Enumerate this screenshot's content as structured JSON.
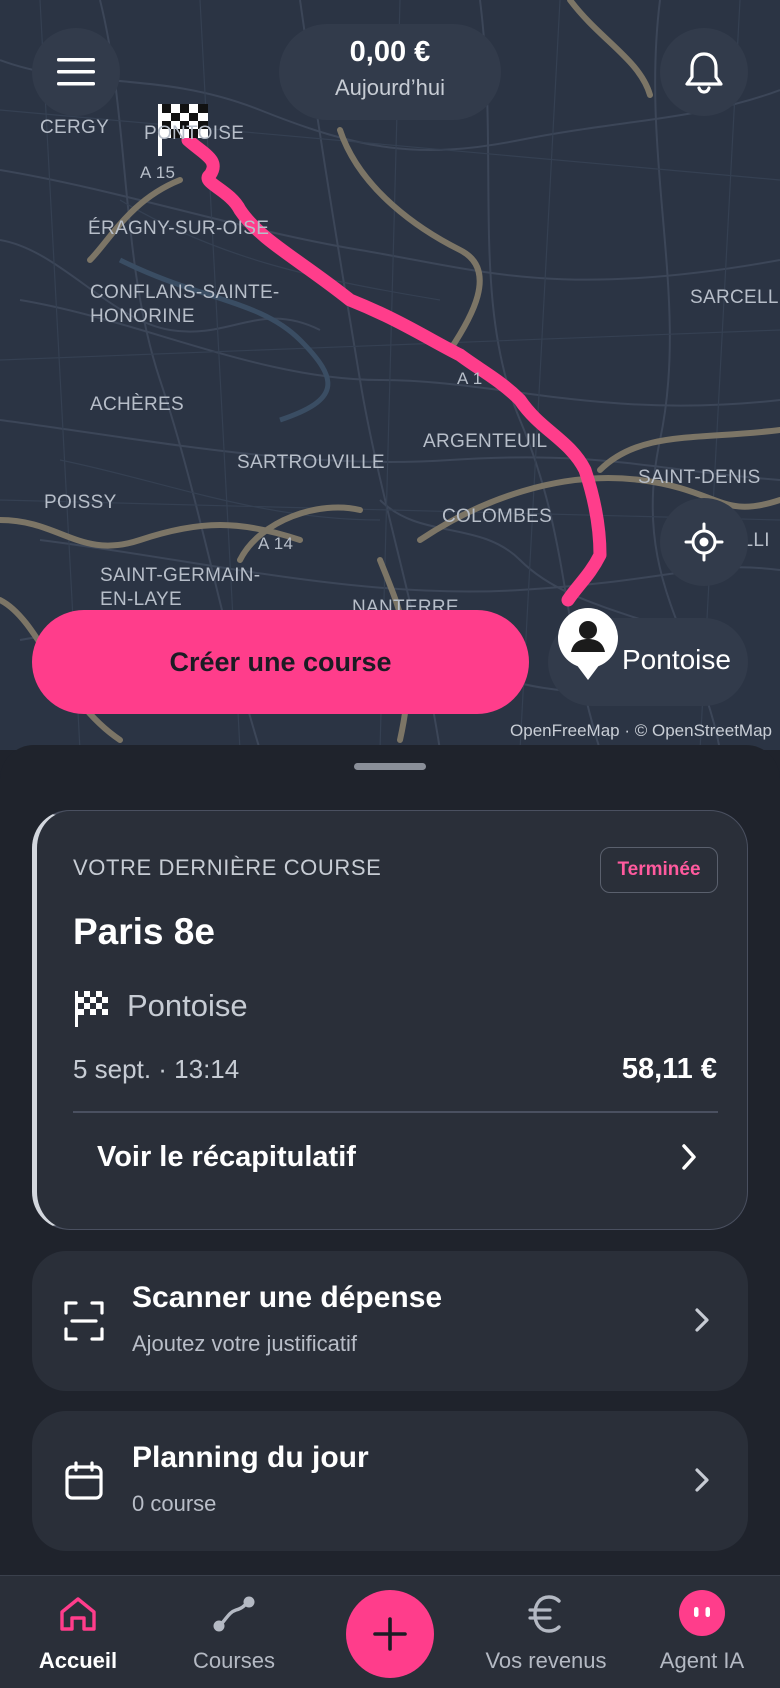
{
  "map": {
    "places": [
      {
        "key": "cergy",
        "label": "CERGY"
      },
      {
        "key": "pontoise",
        "label": "PONTOISE"
      },
      {
        "key": "a15",
        "label": "A 15"
      },
      {
        "key": "eragny",
        "label": "ÉRAGNY-SUR-OISE"
      },
      {
        "key": "conflans1",
        "label": "CONFLANS-SAINTE-"
      },
      {
        "key": "conflans2",
        "label": "HONORINE"
      },
      {
        "key": "sarcelles",
        "label": "SARCELLE"
      },
      {
        "key": "a1",
        "label": "A 1"
      },
      {
        "key": "acheres",
        "label": "ACHÈRES"
      },
      {
        "key": "argenteuil",
        "label": "ARGENTEUIL"
      },
      {
        "key": "sartrouville",
        "label": "SARTROUVILLE"
      },
      {
        "key": "saintdenis",
        "label": "SAINT-DENIS"
      },
      {
        "key": "poissy",
        "label": "POISSY"
      },
      {
        "key": "colombes",
        "label": "COLOMBES"
      },
      {
        "key": "a14",
        "label": "A 14"
      },
      {
        "key": "villi",
        "label": "VILLI"
      },
      {
        "key": "stgermain1",
        "label": "SAINT-GERMAIN-"
      },
      {
        "key": "stgermain2",
        "label": "EN-LAYE"
      },
      {
        "key": "nanterre",
        "label": "NANTERRE"
      }
    ],
    "attribution": "OpenFreeMap · © OpenStreetMap",
    "route_color": "#ff3d8b"
  },
  "header": {
    "menu_icon": "hamburger-icon",
    "earnings_amount": "0,00 €",
    "earnings_label": "Aujourd’hui",
    "bell_icon": "bell-icon"
  },
  "actions": {
    "create_ride": "Créer une course",
    "destination_chip": "Pontoise",
    "locate_icon": "crosshair-icon"
  },
  "last_ride": {
    "heading": "VOTRE DERNIÈRE COURSE",
    "status": "Terminée",
    "origin": "Paris 8e",
    "destination": "Pontoise",
    "datetime": "5 sept. · 13:14",
    "price": "58,11 €",
    "summary_link": "Voir le récapitulatif"
  },
  "cards": {
    "scan": {
      "title": "Scanner une dépense",
      "subtitle": "Ajoutez votre justificatif"
    },
    "planning": {
      "title": "Planning du jour",
      "subtitle": "0 course"
    }
  },
  "tabs": {
    "home": "Accueil",
    "rides": "Courses",
    "revenue": "Vos revenus",
    "agent": "Agent IA"
  },
  "colors": {
    "accent": "#ff3d8b",
    "background": "#1f232c",
    "card": "#2a2f39",
    "map": "#2b3444"
  }
}
